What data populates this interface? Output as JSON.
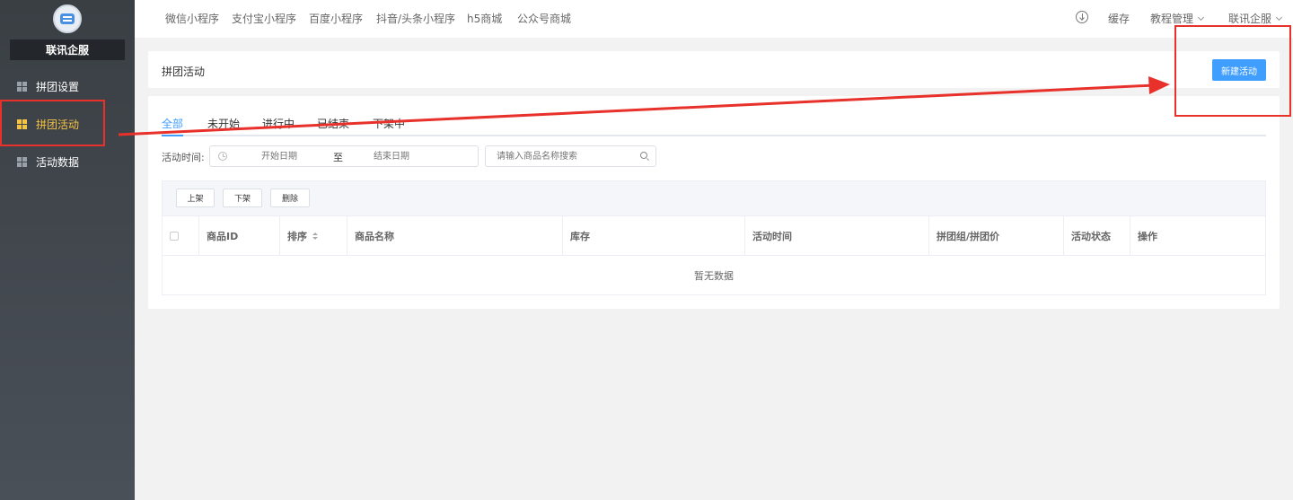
{
  "sidebar": {
    "brand": "联讯企服",
    "items": [
      {
        "label": "拼团设置"
      },
      {
        "label": "拼团活动"
      },
      {
        "label": "活动数据"
      }
    ]
  },
  "topbar": {
    "links": [
      {
        "label": "微信小程序"
      },
      {
        "label": "支付宝小程序"
      },
      {
        "label": "百度小程序"
      },
      {
        "label": "抖音/头条小程序"
      },
      {
        "label": "h5商城"
      },
      {
        "label": "公众号商城"
      }
    ],
    "cache": "缓存",
    "tutorial": "教程管理",
    "account": "联讯企服"
  },
  "header": {
    "title": "拼团活动",
    "new_button": "新建活动"
  },
  "tabs": [
    {
      "label": "全部"
    },
    {
      "label": "未开始"
    },
    {
      "label": "进行中"
    },
    {
      "label": "已结束"
    },
    {
      "label": "下架中"
    }
  ],
  "filter": {
    "label": "活动时间:",
    "start_placeholder": "开始日期",
    "separator": "至",
    "end_placeholder": "结束日期",
    "search_placeholder": "请输入商品名称搜索"
  },
  "toolbar": {
    "shelve": "上架",
    "unshelve": "下架",
    "delete": "删除"
  },
  "table": {
    "columns": [
      "商品ID",
      "排序",
      "商品名称",
      "库存",
      "活动时间",
      "拼团组/拼团价",
      "活动状态",
      "操作"
    ],
    "empty": "暂无数据"
  },
  "colors": {
    "primary": "#409eff",
    "sidebar_active": "#f5c242",
    "annotation": "#e8312a"
  }
}
